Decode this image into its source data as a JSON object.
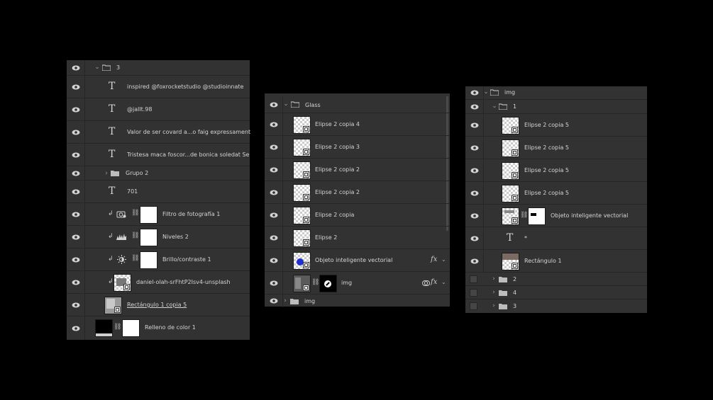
{
  "panel_left": {
    "group_name": "3",
    "layers": [
      {
        "type": "text",
        "name": "inspired @foxrocketstudio @studioinnate"
      },
      {
        "type": "text",
        "name": "@jallt.98"
      },
      {
        "type": "text",
        "name": "Valor de ser covard a...o faig expressament"
      },
      {
        "type": "text",
        "name": "Tristesa maca foscor...de bonica soledat Se"
      },
      {
        "type": "group",
        "name": "Grupo 2"
      },
      {
        "type": "text",
        "name": "701"
      },
      {
        "type": "adjust",
        "name": "Filtro de fotografía 1",
        "icon": "camera-filter-icon"
      },
      {
        "type": "adjust",
        "name": "Niveles 2",
        "icon": "levels-icon"
      },
      {
        "type": "adjust",
        "name": "Brillo/contraste 1",
        "icon": "brightness-icon"
      },
      {
        "type": "image",
        "name": "daniel-olah-srFhtP2Isv4-unsplash"
      },
      {
        "type": "smart",
        "name": "Rectángulo 1 copia 5"
      },
      {
        "type": "fill",
        "name": "Relleno de color 1"
      }
    ]
  },
  "panel_middle": {
    "group_name": "Glass",
    "layers": [
      {
        "name": "Elipse 2 copia 4"
      },
      {
        "name": "Elipse 2 copia 3"
      },
      {
        "name": "Elipse 2 copia 2"
      },
      {
        "name": "Elipse 2 copia 2"
      },
      {
        "name": "Elipse 2 copia"
      },
      {
        "name": "Elipse 2"
      },
      {
        "name": "Objeto inteligente vectorial",
        "fx": "fx"
      },
      {
        "name": "img",
        "fx": "fx"
      }
    ],
    "bottom_group": "img"
  },
  "panel_right": {
    "group_name": "img",
    "subgroup_name": "1",
    "layers": [
      {
        "name": "Elipse 2 copia 5"
      },
      {
        "name": "Elipse 2 copia 5"
      },
      {
        "name": "Elipse 2 copia 5"
      },
      {
        "name": "Elipse 2 copia 5"
      },
      {
        "name": "Objeto inteligente vectorial"
      },
      {
        "name": "*"
      },
      {
        "name": "Rectángulo 1"
      }
    ],
    "hidden_groups": [
      "2",
      "4",
      "3"
    ]
  },
  "icons": {
    "eye": "eye-icon",
    "folder": "folder-icon",
    "chevron": "chevron-icon",
    "link": "link-icon",
    "clip": "clipping-arrow-icon"
  }
}
